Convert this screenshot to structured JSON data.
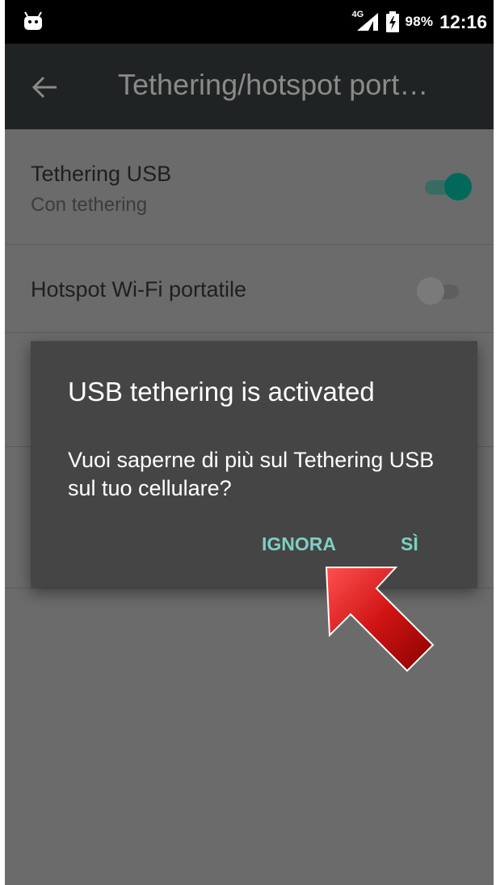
{
  "status_bar": {
    "left_icon": "android-notification-icon",
    "network_label": "4G",
    "battery_percent": "98%",
    "time": "12:16"
  },
  "toolbar": {
    "back_icon": "back-arrow-icon",
    "title": "Tethering/hotspot port…"
  },
  "settings": {
    "items": [
      {
        "title": "Tethering USB",
        "subtitle": "Con tethering",
        "toggle_on": true
      },
      {
        "title": "Hotspot Wi-Fi portatile",
        "subtitle": "",
        "toggle_on": false
      }
    ]
  },
  "dialog": {
    "title": "USB tethering is activated",
    "message": "Vuoi saperne di più sul Tethering USB sul tuo cellulare?",
    "buttons": {
      "ignore": "IGNORA",
      "yes": "SÌ"
    }
  },
  "colors": {
    "accent": "#7ecfc4",
    "toggle_on": "#00695c",
    "pointer_arrow": "#d01414"
  }
}
